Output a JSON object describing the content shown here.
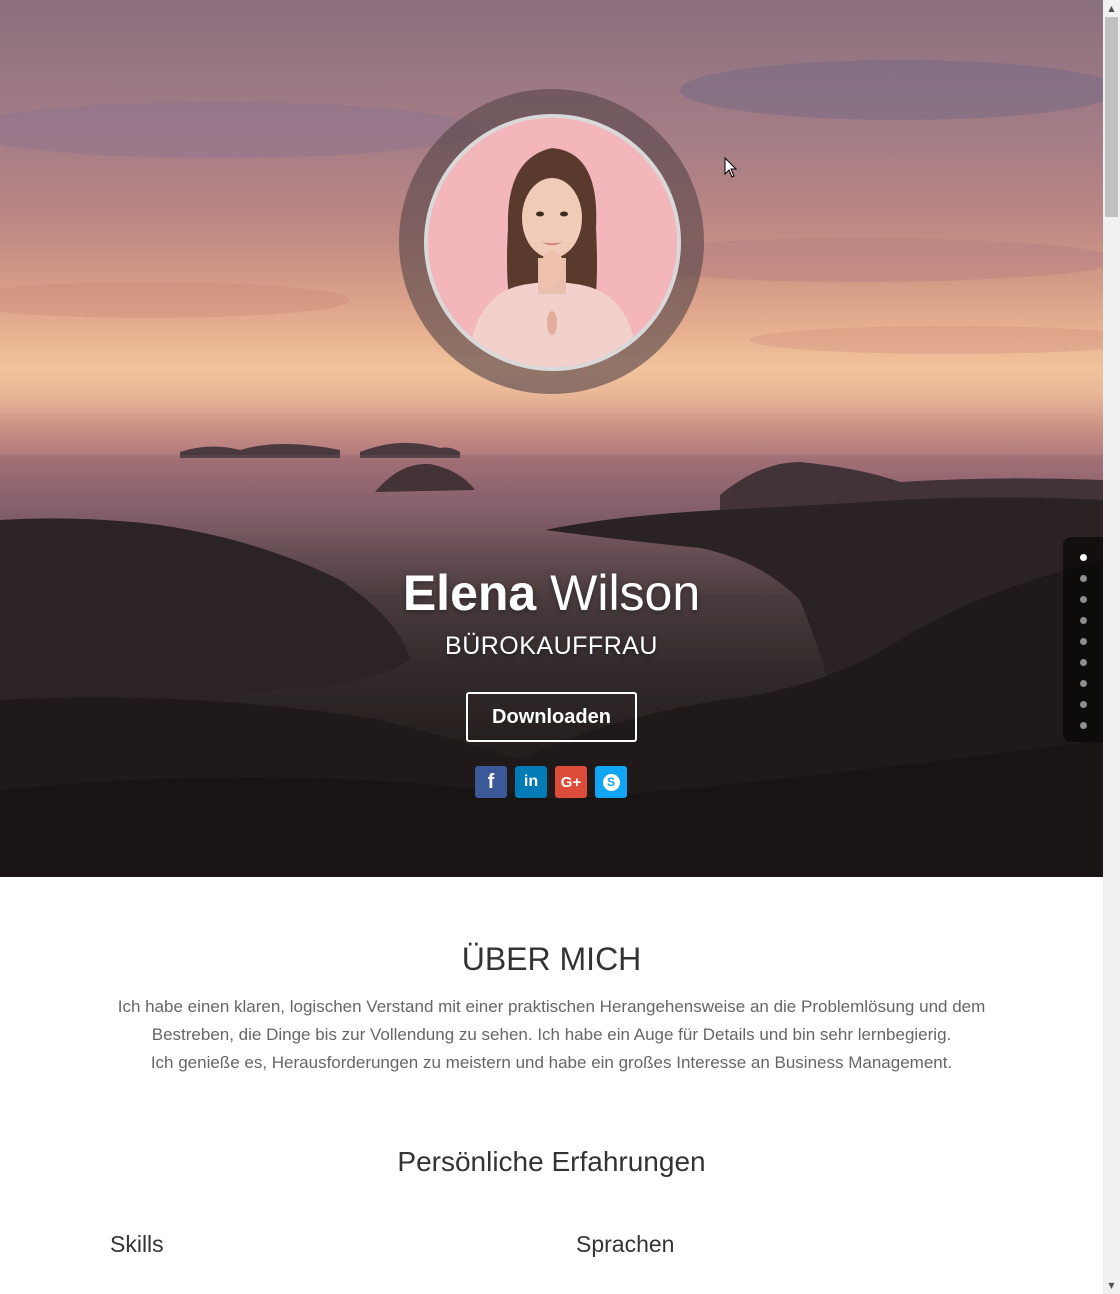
{
  "hero": {
    "first_name": "Elena",
    "last_name": "Wilson",
    "role": "BÜROKAUFFRAU",
    "download_label": "Downloaden",
    "socials": [
      {
        "name": "facebook",
        "glyph": "f",
        "color": "#3b5998"
      },
      {
        "name": "linkedin",
        "glyph": "in",
        "color": "#007bb6"
      },
      {
        "name": "google-plus",
        "glyph": "G+",
        "color": "#dd4b39"
      },
      {
        "name": "skype",
        "glyph": "S",
        "color": "#12a5f4"
      }
    ],
    "nav_dots": 9,
    "active_dot": 0
  },
  "about": {
    "title": "ÜBER MICH",
    "line1": "Ich habe einen klaren, logischen Verstand mit einer praktischen Herangehensweise an die Problemlösung und dem Bestreben, die Dinge bis zur Vollendung zu sehen. Ich habe ein Auge für Details und bin sehr lernbegierig.",
    "line2": "Ich genieße es, Herausforderungen zu meistern und habe ein großes Interesse an Business Management."
  },
  "experience": {
    "title": "Persönliche Erfahrungen",
    "skills_title": "Skills",
    "languages_title": "Sprachen"
  }
}
